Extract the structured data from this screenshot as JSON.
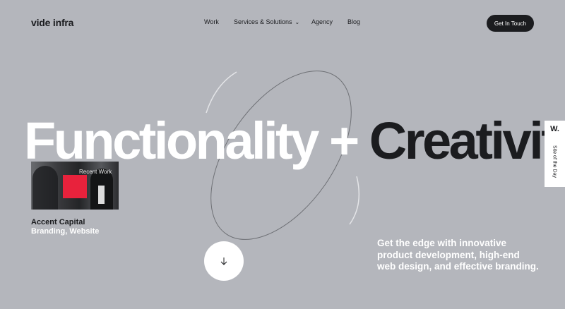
{
  "header": {
    "logo": "vide infra",
    "nav": [
      {
        "label": "Work"
      },
      {
        "label": "Services & Solutions",
        "chevron": "⌄"
      },
      {
        "label": "Agency"
      },
      {
        "label": "Blog"
      }
    ],
    "cta_label": "Get In Touch"
  },
  "hero": {
    "headline_part1": "Functionality +",
    "headline_part2": "Creativity"
  },
  "recent_work": {
    "tag": "Recent Work",
    "title": "Accent Capital",
    "categories": "Branding, Website"
  },
  "tagline": "Get the edge with innovative product development, high-end web design, and effective branding.",
  "award_badge": {
    "mark": "W.",
    "label": "Site of the Day"
  },
  "colors": {
    "background": "#b4b6bc",
    "dark": "#1b1c1f",
    "accent_red": "#e8223c",
    "white": "#ffffff"
  },
  "icons": {
    "scroll": "arrow-down-icon",
    "dropdown": "chevron-down-icon"
  }
}
